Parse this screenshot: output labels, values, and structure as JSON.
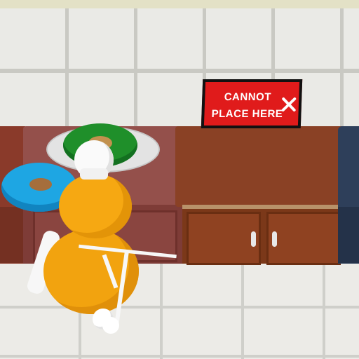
{
  "scene": {
    "kind": "kitchen-game",
    "warning": {
      "text": "CANNOT\nPLACE HERE",
      "background": "#e01b1b",
      "icon": "close-icon"
    },
    "items": {
      "donut_on_plate": "green frosted donut",
      "donut_on_counter": "blue frosted donut"
    },
    "player": "orange chef character with white hat and apron"
  }
}
